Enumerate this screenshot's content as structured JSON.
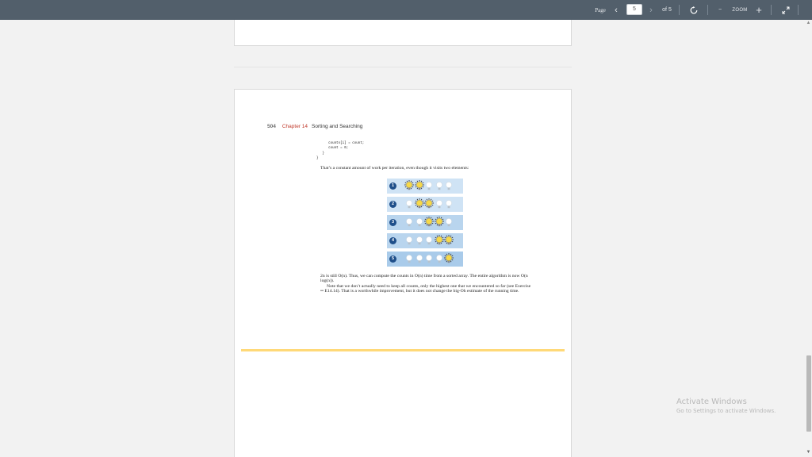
{
  "toolbar": {
    "page_label": "Page",
    "prev_icon": "‹",
    "page_value": "5",
    "next_icon": "›",
    "of_label": "of 5",
    "rotate_icon": "rotate-icon",
    "zoom_out": "−",
    "zoom_label": "ZOOM",
    "zoom_in": "+",
    "expand_icon": "expand-icon"
  },
  "page": {
    "page_number": "504",
    "chapter_label": "Chapter 14",
    "chapter_title": "Sorting and Searching",
    "code_lines": "      counts[i] = count;\n      count = 0;\n   }\n}",
    "paragraph_1": "That’s a constant amount of work per iteration, even though it visits two elements:",
    "steps": [
      {
        "label": "1",
        "lit": [
          0,
          1
        ]
      },
      {
        "label": "2",
        "lit": [
          1,
          2
        ]
      },
      {
        "label": "3",
        "lit": [
          2,
          3
        ]
      },
      {
        "label": "4",
        "lit": [
          3,
          4
        ]
      },
      {
        "label": "5",
        "lit": [
          4
        ]
      }
    ],
    "paragraph_2a": "2n is still O(n). Thus, we can compute the counts in O(n) time from a sorted array. The entire algorithm is now O(n log(n)).",
    "paragraph_2b": "Note that we don’t actually need to keep all counts, only the highest one that we encountered so far (see Exercise •• E14.14). That is a worthwhile improvement, but it does not change the big-Oh estimate of the running time."
  },
  "watermark": {
    "title": "Activate Windows",
    "subtitle": "Go to Settings to activate Windows."
  },
  "colors": {
    "toolbar": "#525f6b",
    "chapter_accent": "#c0392b",
    "highlight_bar": "#ffd978",
    "step_badge": "#1f4f8a"
  }
}
